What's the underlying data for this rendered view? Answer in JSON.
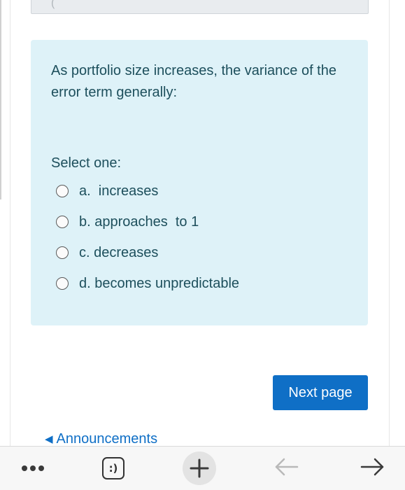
{
  "question": {
    "text": "As portfolio size increases, the variance of the error term generally:",
    "select_label": "Select one:",
    "options": [
      {
        "label": "a.  increases",
        "selected": false
      },
      {
        "label": "b. approaches  to 1",
        "selected": false
      },
      {
        "label": "c. decreases",
        "selected": false
      },
      {
        "label": "d. becomes unpredictable",
        "selected": false
      }
    ]
  },
  "navigation": {
    "next_label": "Next page",
    "prev_arrow": "◀",
    "prev_link_label": "Announcements"
  },
  "toolbar": {
    "smiley_label": ":)"
  },
  "colors": {
    "question_bg": "#def2f8",
    "question_text": "#1d4f5c",
    "accent": "#0f6fc6"
  },
  "icons": [
    "more-icon",
    "smiley-icon",
    "plus-icon",
    "back-arrow-icon",
    "forward-arrow-icon",
    "caret-left-icon"
  ]
}
